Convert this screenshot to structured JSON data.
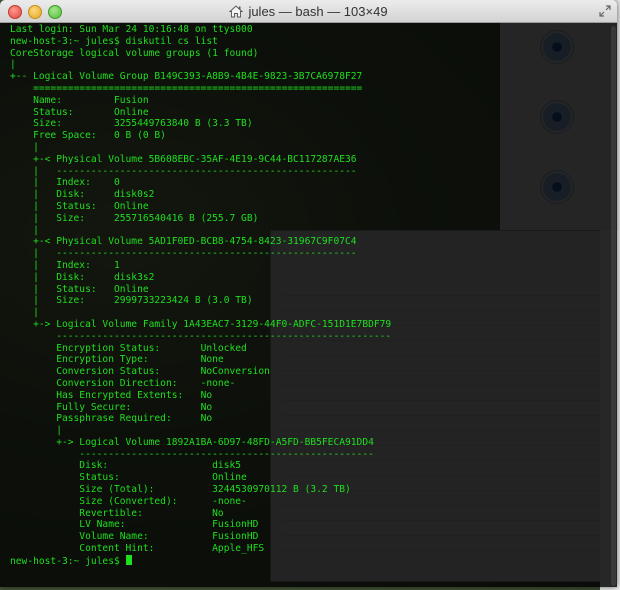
{
  "window": {
    "title": "jules — bash — 103×49"
  },
  "terminal": {
    "prompt": "new-host-3:~ jules$ ",
    "lines": [
      "Last login: Sun Mar 24 10:16:48 on ttys000",
      "new-host-3:~ jules$ diskutil cs list",
      "CoreStorage logical volume groups (1 found)",
      "|",
      "+-- Logical Volume Group B149C393-A8B9-4B4E-9823-3B7CA6978F27",
      "    =========================================================",
      "    Name:         Fusion",
      "    Status:       Online",
      "    Size:         3255449763840 B (3.3 TB)",
      "    Free Space:   0 B (0 B)",
      "    |",
      "    +-< Physical Volume 5B608EBC-35AF-4E19-9C44-BC117287AE36",
      "    |   ----------------------------------------------------",
      "    |   Index:    0",
      "    |   Disk:     disk0s2",
      "    |   Status:   Online",
      "    |   Size:     255716540416 B (255.7 GB)",
      "    |",
      "    +-< Physical Volume 5AD1F0ED-BCB8-4754-8423-31967C9F07C4",
      "    |   ----------------------------------------------------",
      "    |   Index:    1",
      "    |   Disk:     disk3s2",
      "    |   Status:   Online",
      "    |   Size:     2999733223424 B (3.0 TB)",
      "    |",
      "    +-> Logical Volume Family 1A43EAC7-3129-44F0-ADFC-151D1E7BDF79",
      "        ----------------------------------------------------------",
      "        Encryption Status:       Unlocked",
      "        Encryption Type:         None",
      "        Conversion Status:       NoConversion",
      "        Conversion Direction:    -none-",
      "        Has Encrypted Extents:   No",
      "        Fully Secure:            No",
      "        Passphrase Required:     No",
      "        |",
      "        +-> Logical Volume 1892A1BA-6D97-48FD-A5FD-BB5FECA91DD4",
      "            ---------------------------------------------------",
      "            Disk:                  disk5",
      "            Status:                Online",
      "            Size (Total):          3244530970112 B (3.2 TB)",
      "            Size (Converted):      -none-",
      "            Revertible:            No",
      "            LV Name:               FusionHD",
      "            Volume Name:           FusionHD",
      "            Content Hint:          Apple_HFS"
    ]
  },
  "colors": {
    "text": "#1fdf1f",
    "background": "#000000"
  }
}
